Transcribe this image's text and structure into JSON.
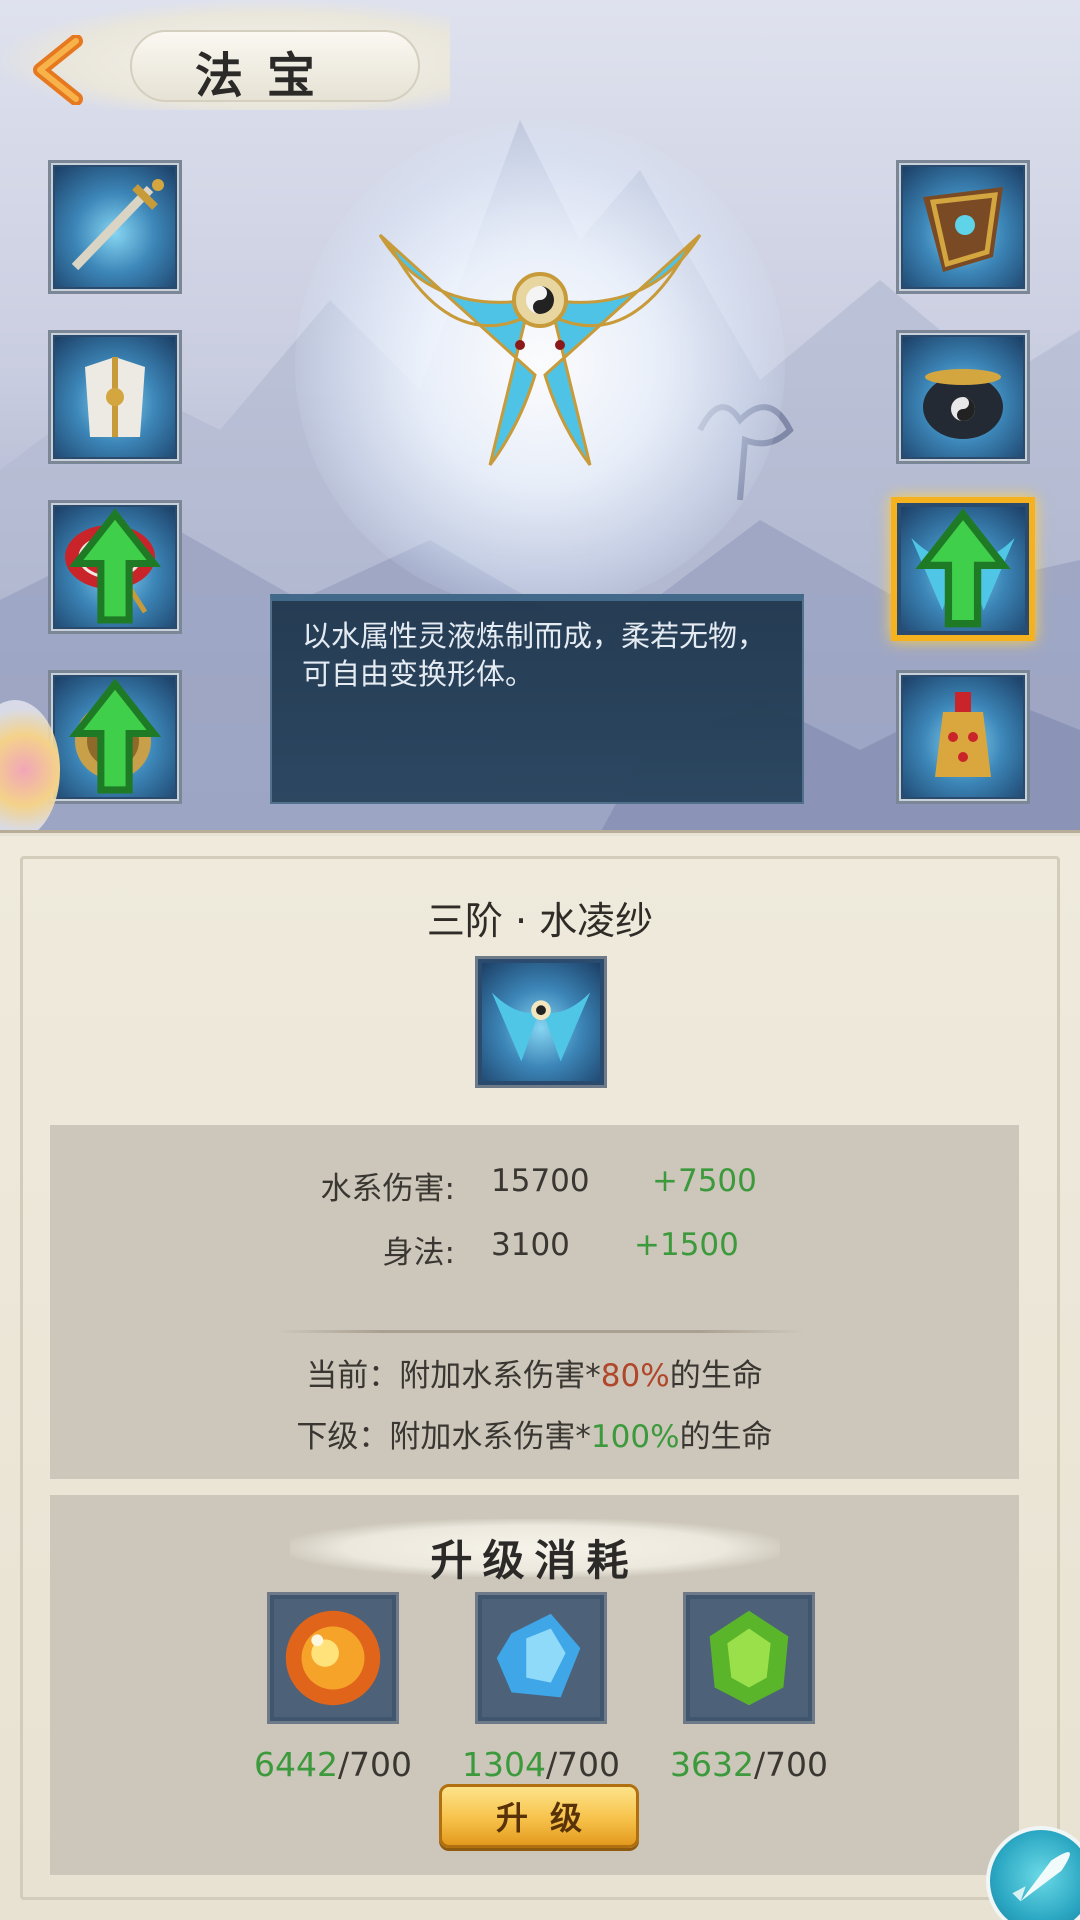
{
  "header": {
    "title": "法宝"
  },
  "description": "以水属性灵液炼制而成，柔若无物，可自由变换形体。",
  "left_slots": [
    {
      "name": "sword",
      "upgradable": false
    },
    {
      "name": "armor",
      "upgradable": false
    },
    {
      "name": "umbrella",
      "upgradable": true
    },
    {
      "name": "seal",
      "upgradable": true
    }
  ],
  "right_slots": [
    {
      "name": "shield",
      "upgradable": false
    },
    {
      "name": "cauldron",
      "upgradable": false
    },
    {
      "name": "water-ribbon",
      "upgradable": true,
      "selected": true
    },
    {
      "name": "bell",
      "upgradable": false
    }
  ],
  "detail": {
    "item_name": "三阶 · 水凌纱",
    "stats": [
      {
        "label": "水系伤害:",
        "value": "15700",
        "bonus": "+7500"
      },
      {
        "label": "身法:",
        "value": "3100",
        "bonus": "+1500"
      }
    ],
    "current_prefix": "当前：附加水系伤害*",
    "current_pct": "80%",
    "current_suffix": "的生命",
    "next_prefix": "下级：附加水系伤害*",
    "next_pct": "100%",
    "next_suffix": "的生命"
  },
  "cost": {
    "title": "升级消耗",
    "materials": [
      {
        "icon": "fire-orb-icon",
        "have": "6442",
        "need": "/700"
      },
      {
        "icon": "ice-crystal-icon",
        "have": "1304",
        "need": "/700"
      },
      {
        "icon": "jade-gem-icon",
        "have": "3632",
        "need": "/700"
      }
    ],
    "button": "升级"
  },
  "colors": {
    "accent_gold": "#f6b21e",
    "positive_green": "#3c9a3c",
    "current_red": "#b0462a"
  }
}
